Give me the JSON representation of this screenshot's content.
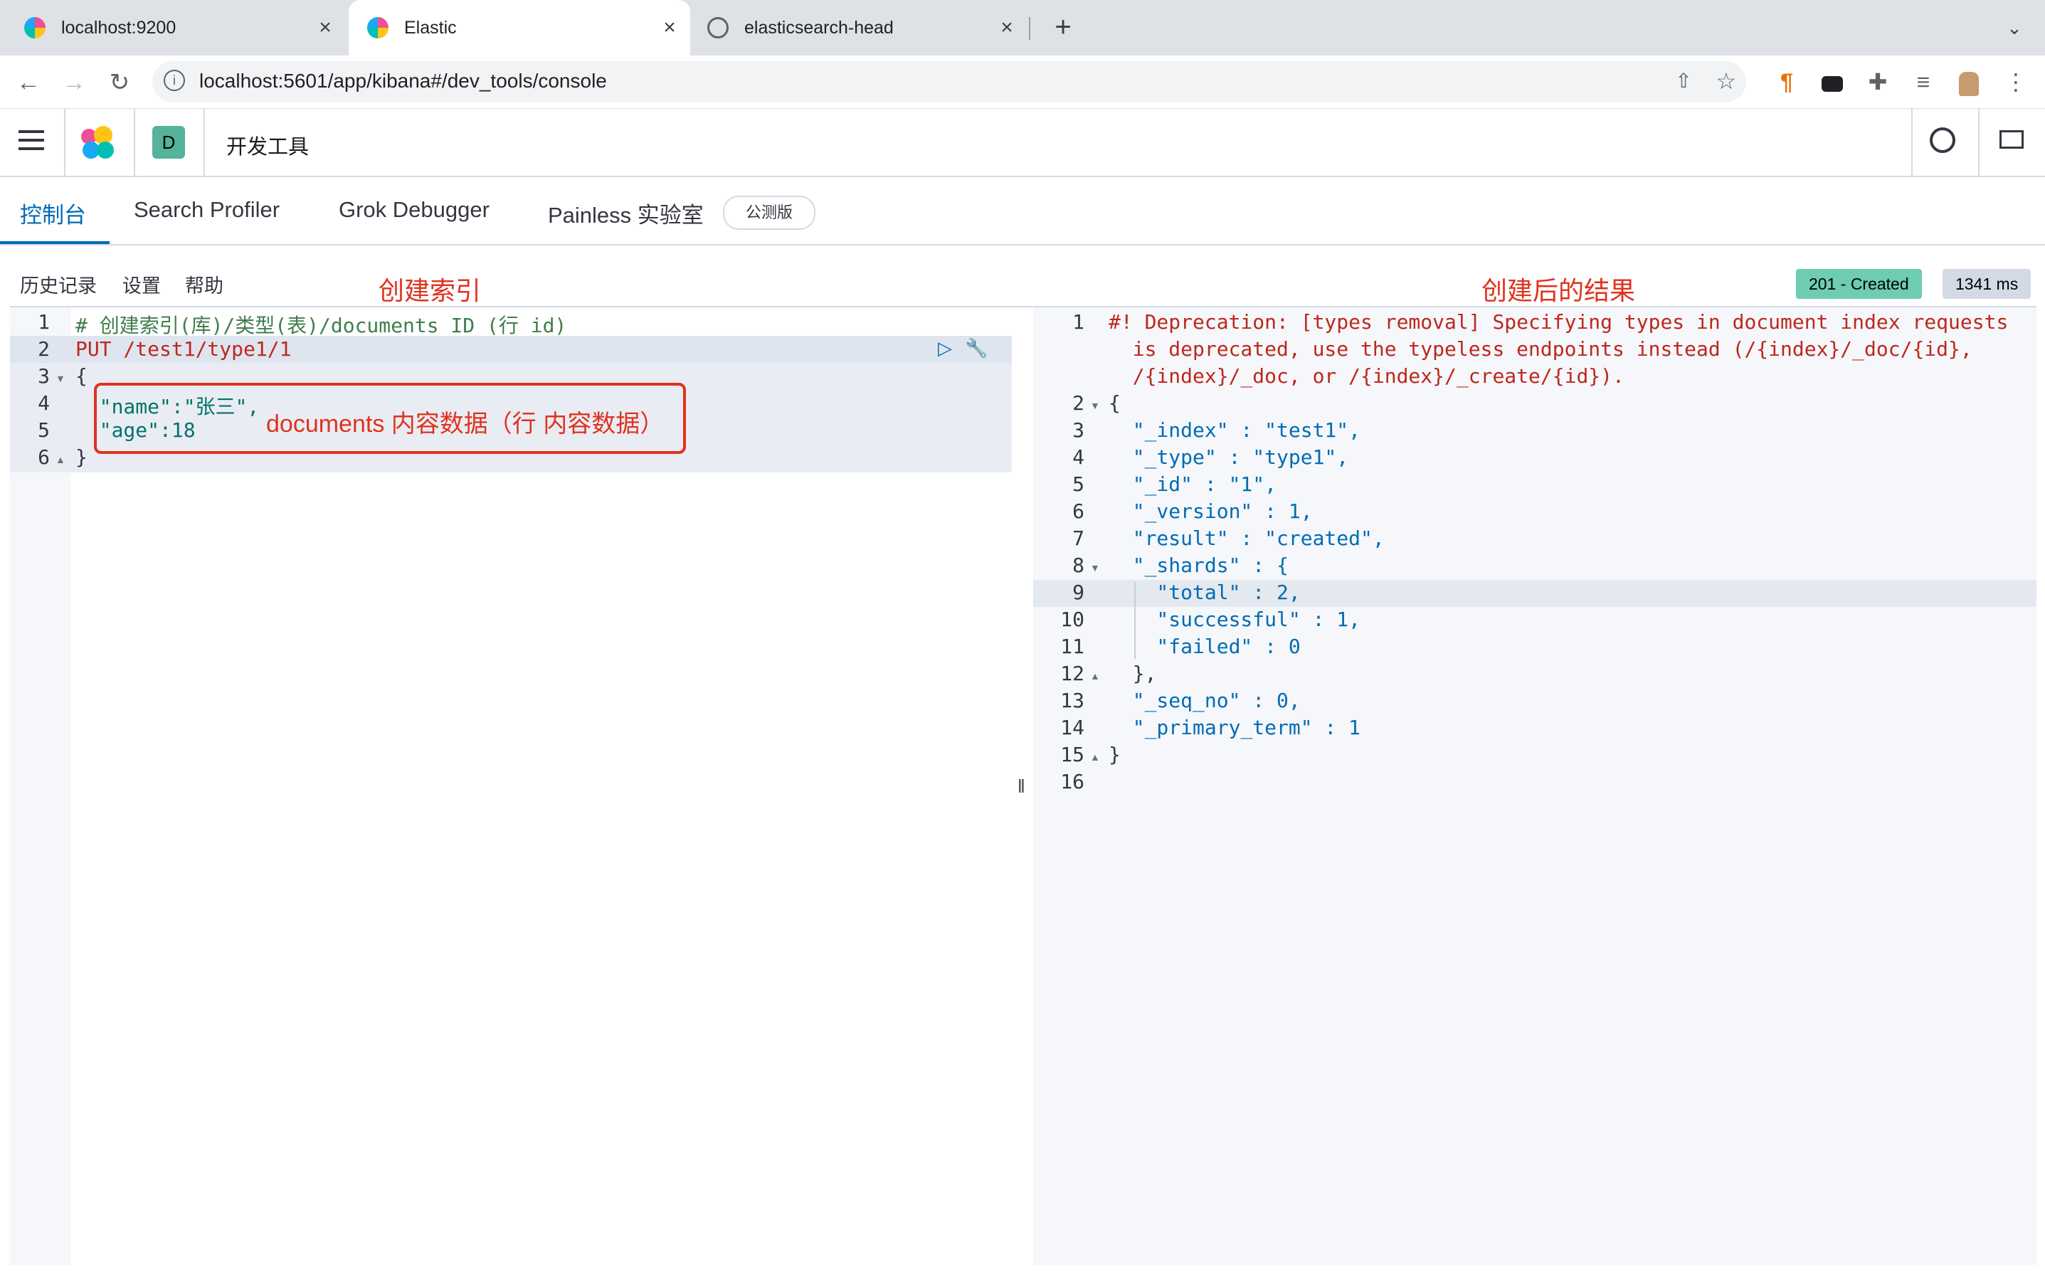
{
  "browser": {
    "tabs": [
      {
        "title": "localhost:9200"
      },
      {
        "title": "Elastic"
      },
      {
        "title": "elasticsearch-head"
      }
    ],
    "url": "localhost:5601/app/kibana#/dev_tools/console"
  },
  "header": {
    "space_avatar": "D",
    "title": "开发工具"
  },
  "devtools_tabs": [
    {
      "label": "控制台"
    },
    {
      "label": "Search Profiler"
    },
    {
      "label": "Grok Debugger"
    },
    {
      "label": "Painless 实验室"
    }
  ],
  "beta_badge": "公测版",
  "console_bar": {
    "history": "历史记录",
    "settings": "设置",
    "help": "帮助"
  },
  "annotations": {
    "left_title": "创建索引",
    "right_title": "创建后的结果",
    "documents_note": "documents 内容数据（行 内容数据）"
  },
  "status": {
    "code": "201 - Created",
    "time": "1341 ms"
  },
  "request_lines": [
    "# 创建索引(库)/类型(表)/documents ID (行 id)",
    "PUT /test1/type1/1",
    "{",
    "  \"name\":\"张三\",",
    "  \"age\":18",
    "}"
  ],
  "response_lines": [
    "#! Deprecation: [types removal] Specifying types in document index requests",
    "  is deprecated, use the typeless endpoints instead (/{index}/_doc/{id},",
    "  /{index}/_doc, or /{index}/_create/{id}).",
    "{",
    "  \"_index\" : \"test1\",",
    "  \"_type\" : \"type1\",",
    "  \"_id\" : \"1\",",
    "  \"_version\" : 1,",
    "  \"result\" : \"created\",",
    "  \"_shards\" : {",
    "    \"total\" : 2,",
    "    \"successful\" : 1,",
    "    \"failed\" : 0",
    "  },",
    "  \"_seq_no\" : 0,",
    "  \"_primary_term\" : 1",
    "}",
    ""
  ],
  "response_line_numbers": [
    "1",
    "2",
    "3",
    "4",
    "5",
    "6",
    "7",
    "8",
    "9",
    "10",
    "11",
    "12",
    "13",
    "14",
    "15",
    "16"
  ],
  "request_line_numbers": [
    "1",
    "2",
    "3",
    "4",
    "5",
    "6"
  ],
  "colors": {
    "accent": "#006bb4",
    "success_badge": "#6dccb1",
    "annotation": "#e0321f"
  }
}
